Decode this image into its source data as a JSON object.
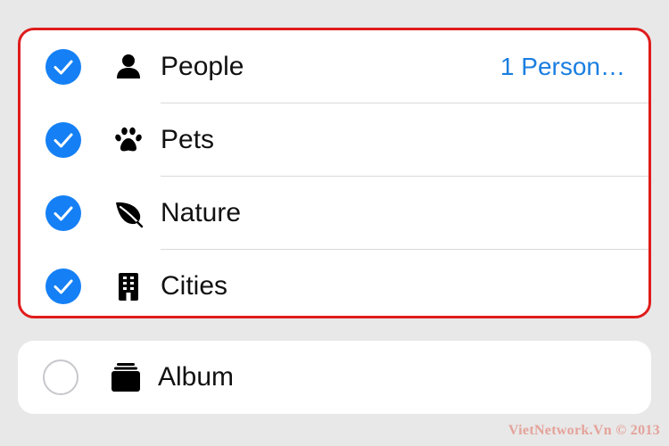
{
  "highlighted_group": {
    "rows": [
      {
        "label": "People",
        "value": "1 Person…",
        "checked": true,
        "icon": "person-icon"
      },
      {
        "label": "Pets",
        "checked": true,
        "icon": "paw-icon"
      },
      {
        "label": "Nature",
        "checked": true,
        "icon": "leaf-icon"
      },
      {
        "label": "Cities",
        "checked": true,
        "icon": "building-icon"
      }
    ],
    "highlight_color": "#e01c1c"
  },
  "album_group": {
    "label": "Album",
    "checked": false,
    "icon": "album-stack-icon"
  },
  "colors": {
    "accent": "#1580f5",
    "value_text": "#1a7ee0",
    "background": "#e8e8e8"
  },
  "watermark": "VietNetwork.Vn © 2013"
}
